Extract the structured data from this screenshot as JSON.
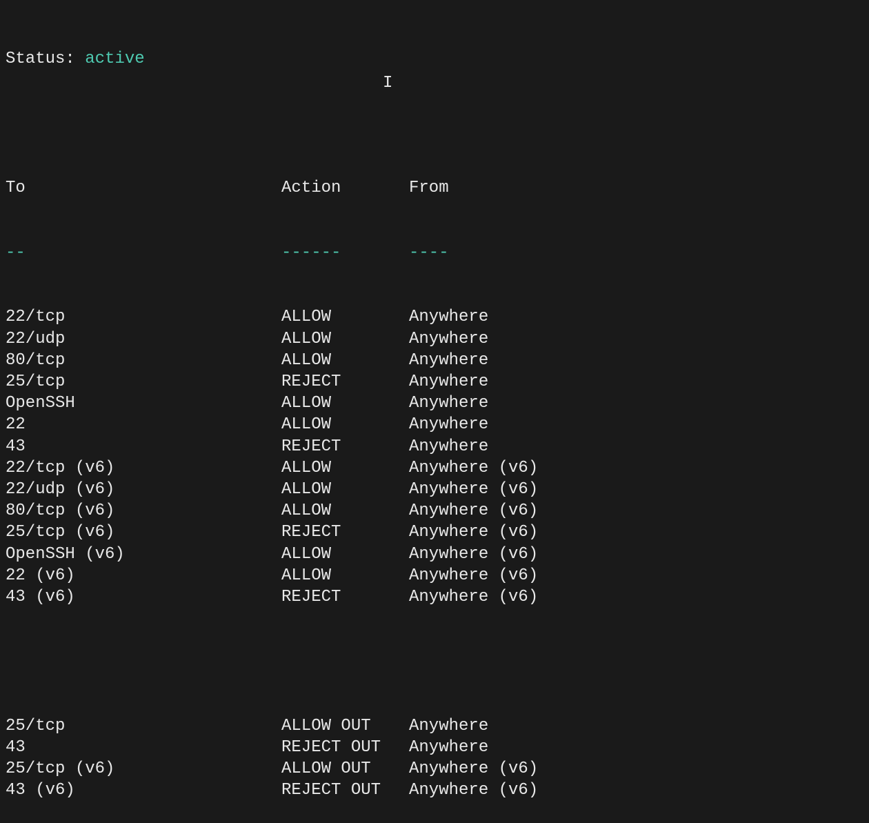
{
  "status": {
    "label": "Status:",
    "value": "active"
  },
  "headers": {
    "to": "To",
    "action": "Action",
    "from": "From"
  },
  "dashes": {
    "to": "--",
    "action": "------",
    "from": "----"
  },
  "rules_in": [
    {
      "to": "22/tcp",
      "action": "ALLOW",
      "from": "Anywhere"
    },
    {
      "to": "22/udp",
      "action": "ALLOW",
      "from": "Anywhere"
    },
    {
      "to": "80/tcp",
      "action": "ALLOW",
      "from": "Anywhere"
    },
    {
      "to": "25/tcp",
      "action": "REJECT",
      "from": "Anywhere"
    },
    {
      "to": "OpenSSH",
      "action": "ALLOW",
      "from": "Anywhere"
    },
    {
      "to": "22",
      "action": "ALLOW",
      "from": "Anywhere"
    },
    {
      "to": "43",
      "action": "REJECT",
      "from": "Anywhere"
    },
    {
      "to": "22/tcp (v6)",
      "action": "ALLOW",
      "from": "Anywhere (v6)"
    },
    {
      "to": "22/udp (v6)",
      "action": "ALLOW",
      "from": "Anywhere (v6)"
    },
    {
      "to": "80/tcp (v6)",
      "action": "ALLOW",
      "from": "Anywhere (v6)"
    },
    {
      "to": "25/tcp (v6)",
      "action": "REJECT",
      "from": "Anywhere (v6)"
    },
    {
      "to": "OpenSSH (v6)",
      "action": "ALLOW",
      "from": "Anywhere (v6)"
    },
    {
      "to": "22 (v6)",
      "action": "ALLOW",
      "from": "Anywhere (v6)"
    },
    {
      "to": "43 (v6)",
      "action": "REJECT",
      "from": "Anywhere (v6)"
    }
  ],
  "rules_out": [
    {
      "to": "25/tcp",
      "action": "ALLOW OUT",
      "from": "Anywhere"
    },
    {
      "to": "43",
      "action": "REJECT OUT",
      "from": "Anywhere"
    },
    {
      "to": "25/tcp (v6)",
      "action": "ALLOW OUT",
      "from": "Anywhere (v6)"
    },
    {
      "to": "43 (v6)",
      "action": "REJECT OUT",
      "from": "Anywhere (v6)"
    }
  ],
  "cursor_char": "I"
}
